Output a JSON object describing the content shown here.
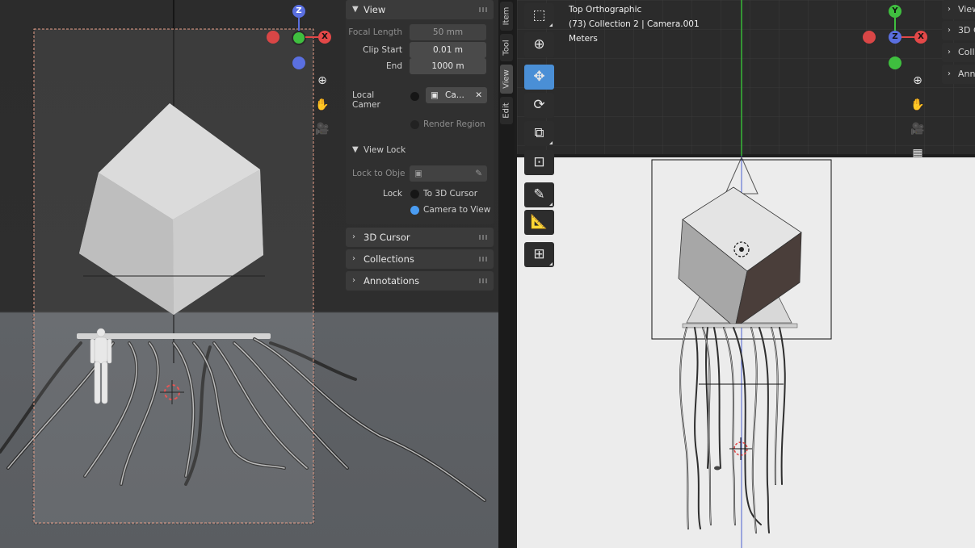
{
  "left_viewport": {
    "gizmo": {
      "z": "Z",
      "x": "X"
    }
  },
  "view_panel": {
    "title": "View",
    "focal_length": {
      "label": "Focal Length",
      "value": "50 mm"
    },
    "clip_start": {
      "label": "Clip Start",
      "value": "0.01 m"
    },
    "clip_end": {
      "label": "End",
      "value": "1000 m"
    },
    "local_camera": {
      "label": "Local Camer",
      "value": "Ca..."
    },
    "render_region": {
      "label": "Render Region"
    },
    "view_lock": {
      "title": "View Lock",
      "lock_to_object": {
        "label": "Lock to Obje"
      },
      "lock": {
        "label": "Lock",
        "to_3d_cursor": "To 3D Cursor",
        "camera_to_view": "Camera to View"
      }
    }
  },
  "collapsed_panels": [
    {
      "label": "3D Cursor"
    },
    {
      "label": "Collections"
    },
    {
      "label": "Annotations"
    }
  ],
  "sidebar_tabs": [
    "Item",
    "Tool",
    "View",
    "Edit"
  ],
  "right_viewport": {
    "view_name": "Top Orthographic",
    "collection_info": "(73) Collection 2 | Camera.001",
    "units": "Meters",
    "gizmo": {
      "y": "Y",
      "z": "Z",
      "x": "X"
    },
    "tabs_cut": [
      {
        "label": "View"
      },
      {
        "label": "3D C"
      },
      {
        "label": "Coll"
      },
      {
        "label": "Ann"
      }
    ]
  },
  "colors": {
    "active_blue": "#4a8fd6",
    "radio_on": "#4a9cf2",
    "axis_red": "#e34848",
    "axis_green": "#3fbf3f",
    "axis_blue": "#5a6fe0"
  }
}
